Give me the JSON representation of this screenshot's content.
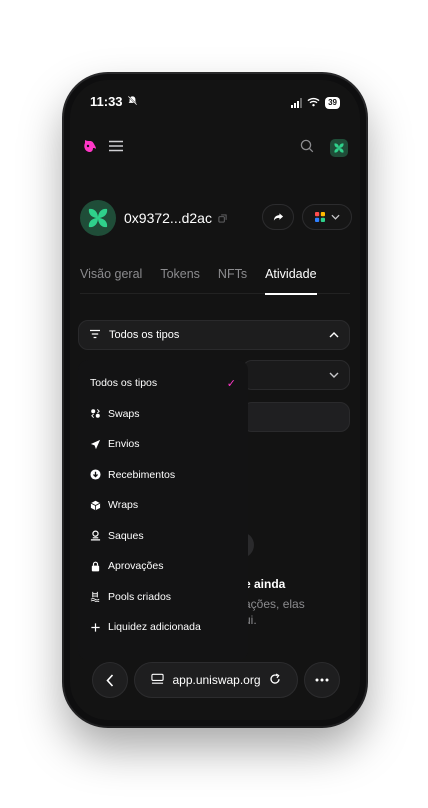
{
  "status_bar": {
    "time": "11:33",
    "battery": "39"
  },
  "wallet": {
    "address": "0x9372...d2ac"
  },
  "tabs": [
    {
      "label": "Visão geral",
      "active": false
    },
    {
      "label": "Tokens",
      "active": false
    },
    {
      "label": "NFTs",
      "active": false
    },
    {
      "label": "Atividade",
      "active": true
    }
  ],
  "filter": {
    "label": "Todos os tipos"
  },
  "dropdown": {
    "items": [
      {
        "label": "Todos os tipos",
        "icon": "check-icon",
        "selected": true
      },
      {
        "label": "Swaps",
        "icon": "swap-icon"
      },
      {
        "label": "Envios",
        "icon": "send-icon"
      },
      {
        "label": "Recebimentos",
        "icon": "receive-icon"
      },
      {
        "label": "Wraps",
        "icon": "wrap-icon"
      },
      {
        "label": "Saques",
        "icon": "withdraw-icon"
      },
      {
        "label": "Aprovações",
        "icon": "lock-icon"
      },
      {
        "label": "Pools criados",
        "icon": "pool-icon"
      },
      {
        "label": "Liquidez adicionada",
        "icon": "plus-icon"
      }
    ]
  },
  "background": {
    "text1": "e ainda",
    "text2": "ações, elas",
    "text3": "ui."
  },
  "browser": {
    "url": "app.uniswap.org"
  },
  "colors": {
    "accent": "#ff37c7",
    "brand_green": "#2fd18b",
    "background": "#131313"
  }
}
